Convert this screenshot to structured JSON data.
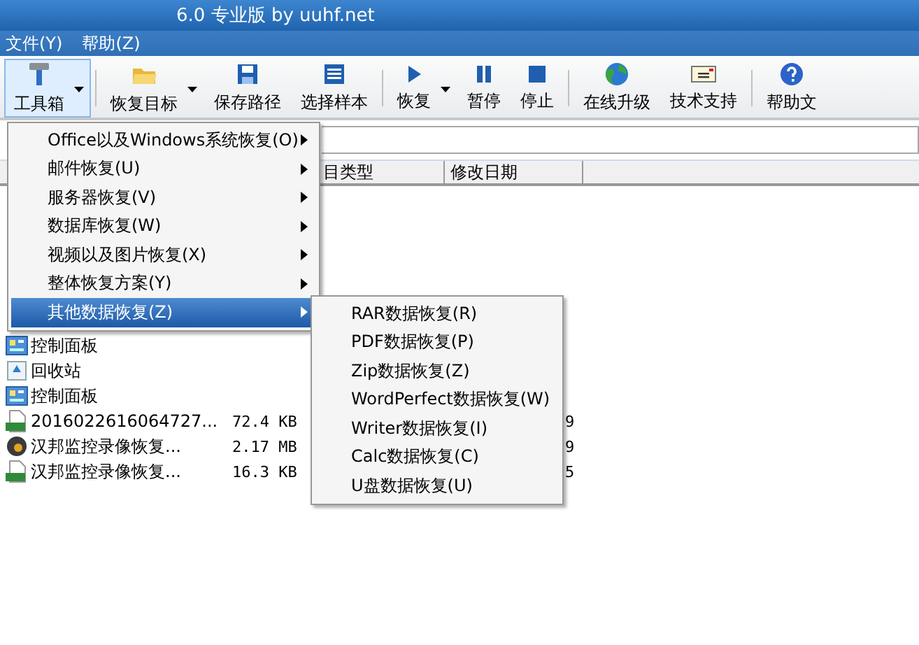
{
  "window": {
    "title": "6.0 专业版 by uuhf.net"
  },
  "menu_bar": [
    "文件(Y)",
    "帮助(Z)"
  ],
  "toolbar": [
    {
      "kind": "button",
      "label": "工具箱",
      "dropdown": true,
      "selected": true
    },
    {
      "kind": "separator"
    },
    {
      "kind": "button",
      "label": "恢复目标",
      "dropdown": true,
      "selected": false
    },
    {
      "kind": "button",
      "label": "保存路径",
      "dropdown": false,
      "selected": false
    },
    {
      "kind": "button",
      "label": "选择样本",
      "dropdown": false,
      "selected": false
    },
    {
      "kind": "separator"
    },
    {
      "kind": "button",
      "label": "恢复",
      "dropdown": true,
      "selected": false
    },
    {
      "kind": "button",
      "label": "暂停",
      "dropdown": false,
      "selected": false
    },
    {
      "kind": "button",
      "label": "停止",
      "dropdown": false,
      "selected": false
    },
    {
      "kind": "separator"
    },
    {
      "kind": "button",
      "label": "在线升级",
      "dropdown": false,
      "selected": false
    },
    {
      "kind": "button",
      "label": "技术支持",
      "dropdown": false,
      "selected": false
    },
    {
      "kind": "separator"
    },
    {
      "kind": "button",
      "label": "帮助文",
      "dropdown": false,
      "selected": false
    }
  ],
  "table": {
    "columns": [
      "目类型",
      "修改日期"
    ],
    "rows": [
      {
        "name": "控制面板",
        "size": "",
        "date": ""
      },
      {
        "name": "回收站",
        "size": "",
        "date": ""
      },
      {
        "name": "控制面板",
        "size": "",
        "date": ""
      },
      {
        "name": "2016022616064727...",
        "size": "72.4 KB",
        "date": "9"
      },
      {
        "name": "汉邦监控录像恢复...",
        "size": "2.17 MB",
        "date": "9"
      },
      {
        "name": "汉邦监控录像恢复...",
        "size": "16.3 KB",
        "date": "5"
      }
    ]
  },
  "tools_menu": {
    "items": [
      {
        "label": "Office以及Windows系统恢复(O)",
        "submenu": true,
        "selected": false
      },
      {
        "label": "邮件恢复(U)",
        "submenu": true,
        "selected": false
      },
      {
        "label": "服务器恢复(V)",
        "submenu": true,
        "selected": false
      },
      {
        "label": "数据库恢复(W)",
        "submenu": true,
        "selected": false
      },
      {
        "label": "视频以及图片恢复(X)",
        "submenu": true,
        "selected": false
      },
      {
        "label": "整体恢复方案(Y)",
        "submenu": true,
        "selected": false
      },
      {
        "label": "其他数据恢复(Z)",
        "submenu": true,
        "selected": true
      }
    ]
  },
  "submenu": {
    "items": [
      {
        "label": "RAR数据恢复(R)",
        "selected": false
      },
      {
        "label": "PDF数据恢复(P)",
        "selected": false
      },
      {
        "label": "Zip数据恢复(Z)",
        "selected": false
      },
      {
        "label": "WordPerfect数据恢复(W)",
        "selected": false
      },
      {
        "label": "Writer数据恢复(I)",
        "selected": false
      },
      {
        "label": "Calc数据恢复(C)",
        "selected": false
      },
      {
        "label": "U盘数据恢复(U)",
        "selected": false
      }
    ]
  }
}
